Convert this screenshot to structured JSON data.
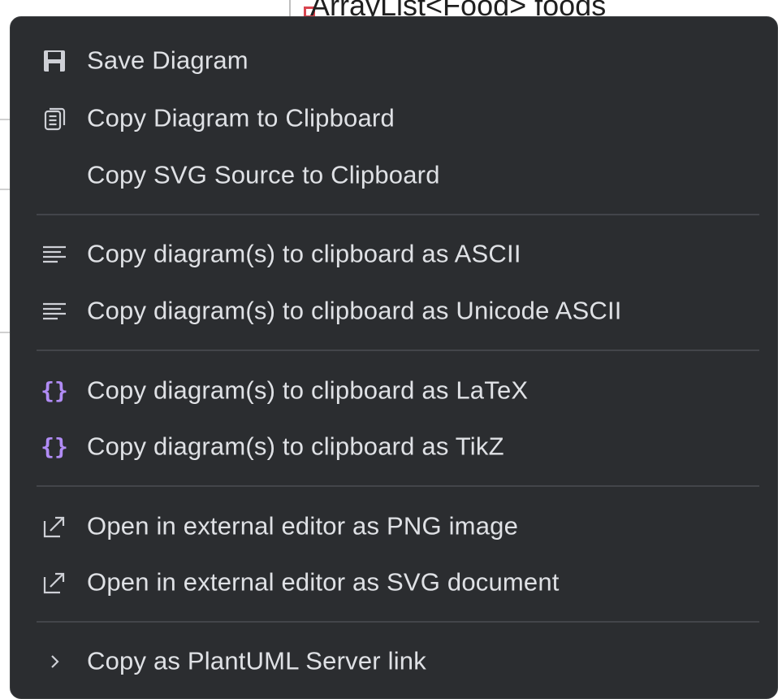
{
  "background": {
    "code_line": "ArrayList<Food> foods"
  },
  "menu": {
    "items": [
      {
        "label": "Save Diagram",
        "icon": "save-icon"
      },
      {
        "label": "Copy Diagram to Clipboard",
        "icon": "copy-icon"
      },
      {
        "label": "Copy SVG Source to Clipboard",
        "icon": ""
      },
      {
        "label": "Copy diagram(s) to clipboard as ASCII",
        "icon": "text-lines-icon"
      },
      {
        "label": "Copy diagram(s) to clipboard as Unicode ASCII",
        "icon": "text-lines-icon"
      },
      {
        "label": "Copy diagram(s) to clipboard as LaTeX",
        "icon": "braces-icon"
      },
      {
        "label": "Copy diagram(s) to clipboard as TikZ",
        "icon": "braces-icon"
      },
      {
        "label": "Open in external editor as PNG image",
        "icon": "external-link-icon"
      },
      {
        "label": "Open in external editor as SVG document",
        "icon": "external-link-icon"
      },
      {
        "label": "Copy as PlantUML Server link",
        "icon": "chevron-right-icon"
      }
    ]
  },
  "colors": {
    "menu_background": "#2b2d30",
    "menu_text": "#dfe1e5",
    "separator": "#43454a",
    "braces_accent": "#b18cf5",
    "field_icon": "#d9454f"
  }
}
